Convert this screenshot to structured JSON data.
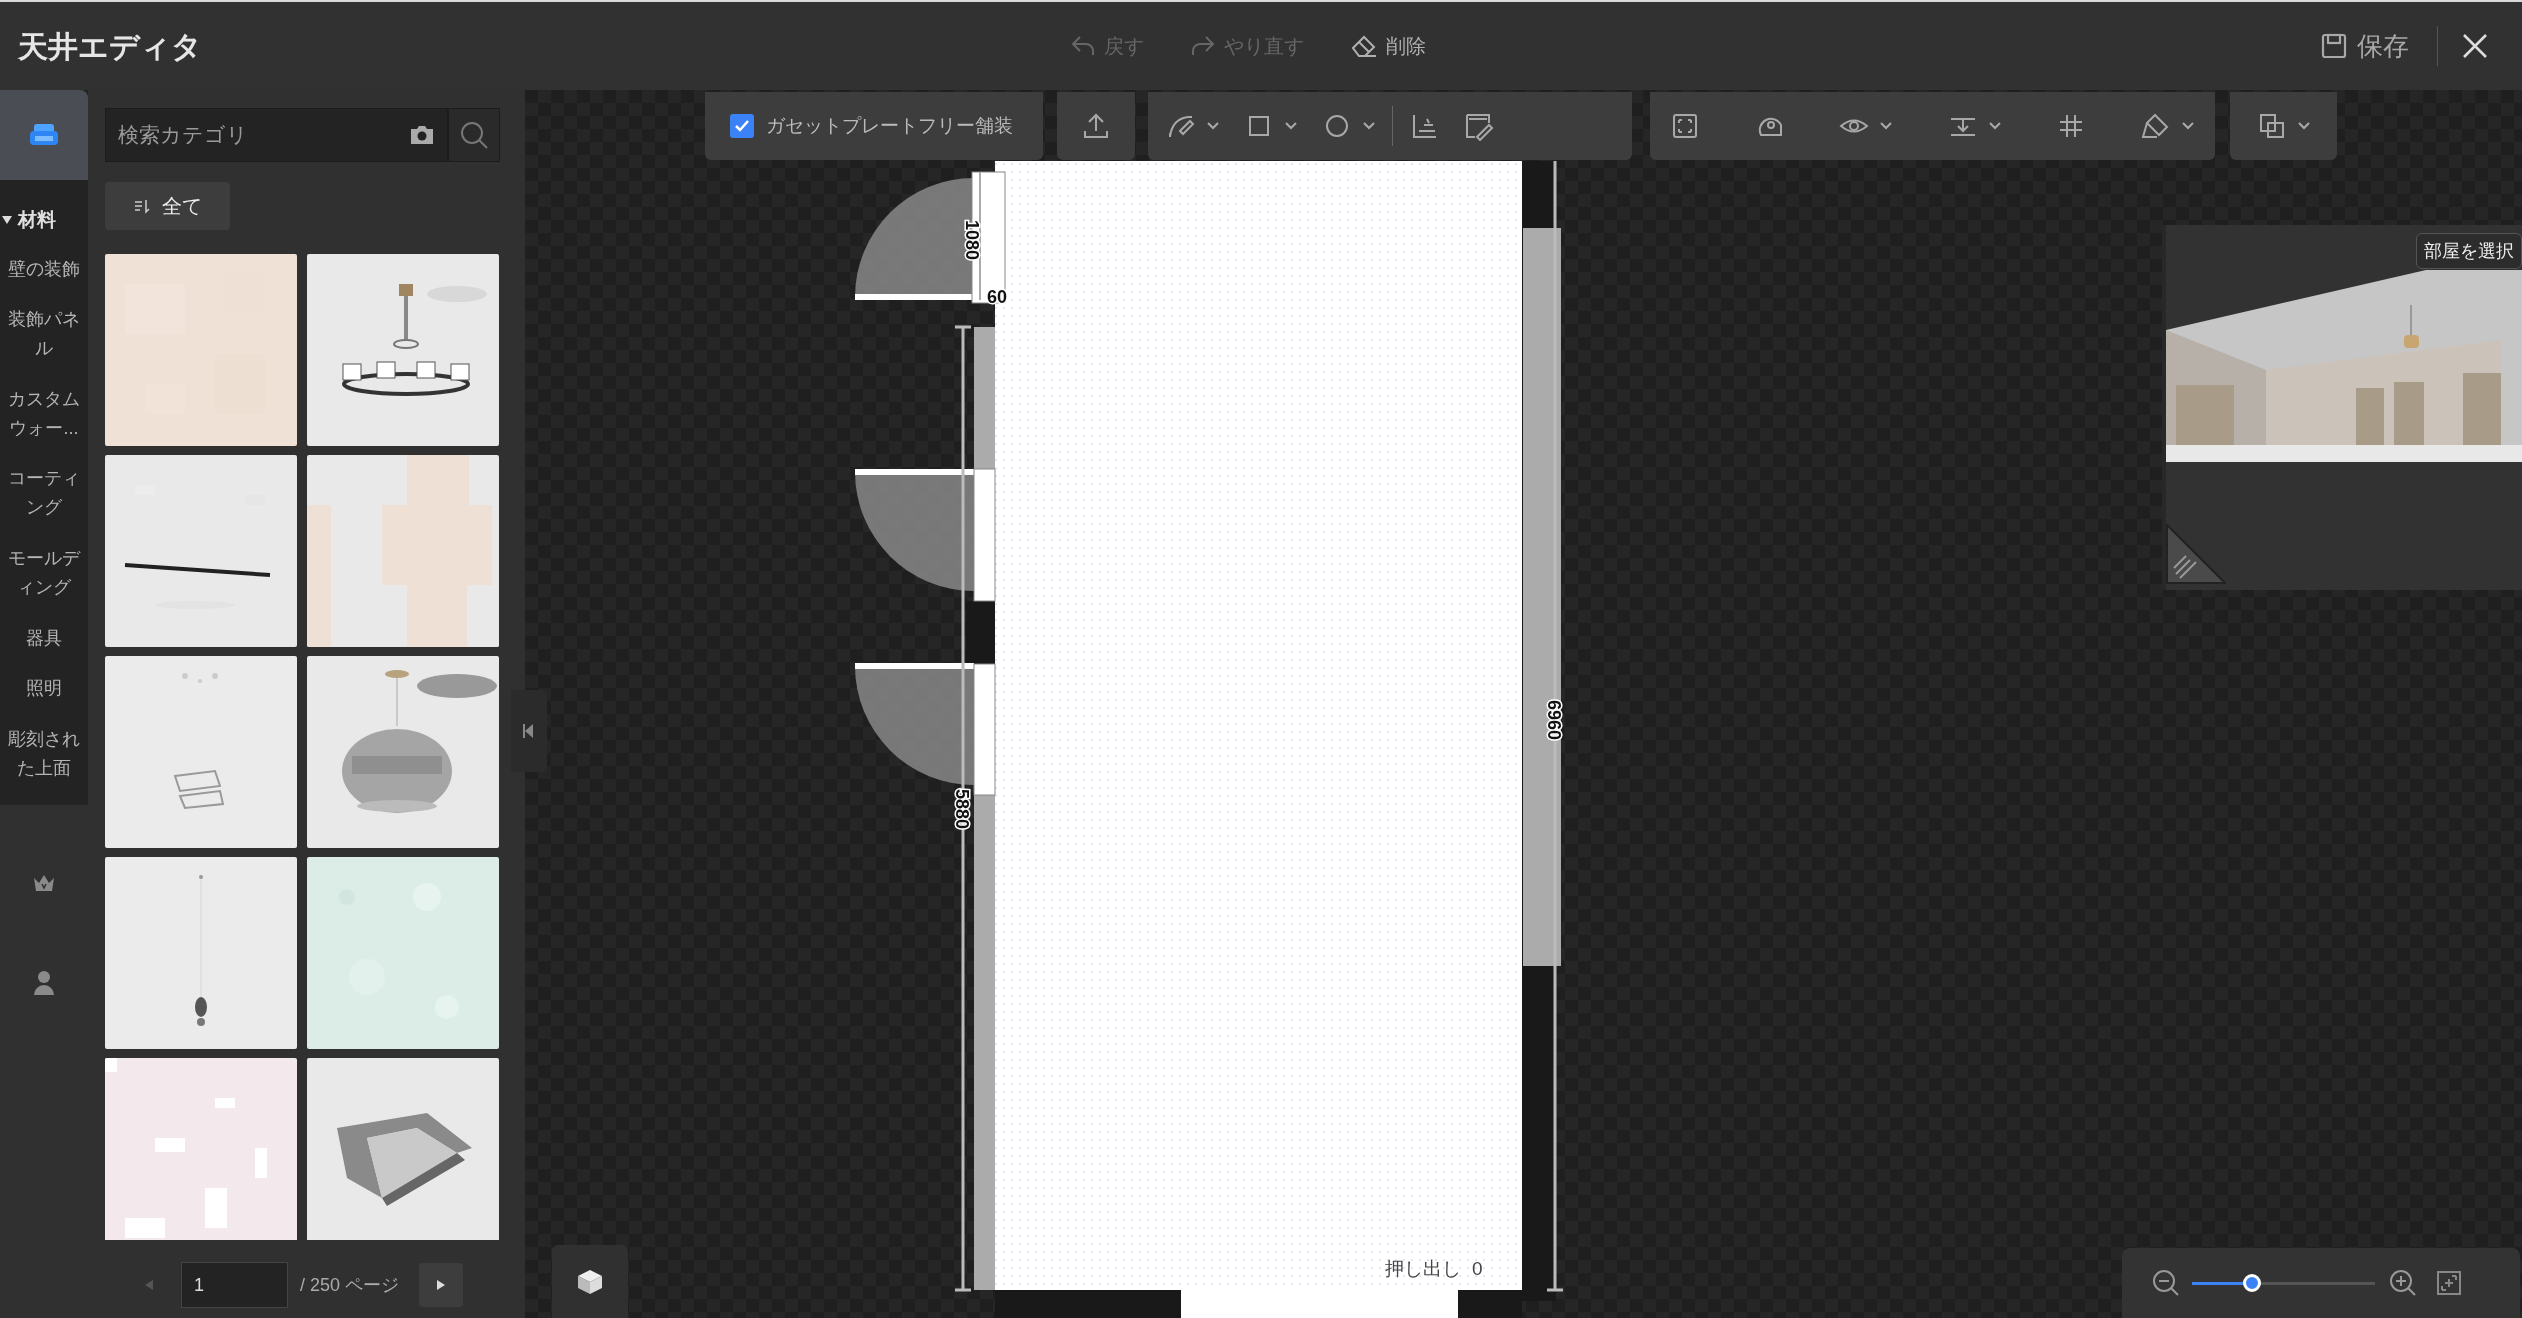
{
  "window": {
    "title": "天井エディタ"
  },
  "header_actions": [
    {
      "label": "戻す",
      "disabled": true
    },
    {
      "label": "やり直す",
      "disabled": true
    },
    {
      "label": "削除",
      "disabled": false
    }
  ],
  "save_button": {
    "label": "保存"
  },
  "rail_icons": [
    {
      "selected": true
    },
    {
      "selected": false
    },
    {
      "selected": false
    }
  ],
  "category_tree": {
    "label": "材料",
    "expanded": true,
    "children": [
      {
        "label": "壁の装飾"
      },
      {
        "label": "装飾パネル"
      },
      {
        "label": "カスタムウォー..."
      },
      {
        "label": "コーティング"
      },
      {
        "label": "モールディング"
      },
      {
        "label": "器具"
      },
      {
        "label": "照明"
      },
      {
        "label": "彫刻された上面"
      }
    ]
  },
  "search": {
    "placeholder": "検索カテゴリ"
  },
  "filter_button": {
    "label": "全て"
  },
  "pagination": {
    "page": "1",
    "total": "/ 250 ページ"
  },
  "toolbar": {
    "option": {
      "label": "ガセットプレートフリー舗装",
      "checked": true
    }
  },
  "floor_plan": {
    "dimension_labels": [
      "1080",
      "60",
      "5880",
      "6960"
    ],
    "extrude_label": "押し出し",
    "extrude_value": "0"
  },
  "preview": {
    "button": "部屋を選択"
  },
  "zoom": {
    "level": 0.33
  }
}
